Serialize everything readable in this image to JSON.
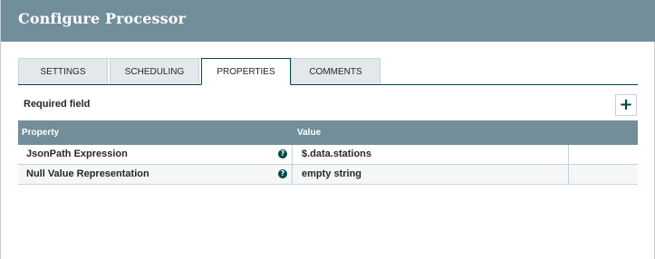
{
  "dialog": {
    "title": "Configure Processor"
  },
  "tabs": [
    {
      "label": "SETTINGS"
    },
    {
      "label": "SCHEDULING"
    },
    {
      "label": "PROPERTIES"
    },
    {
      "label": "COMMENTS"
    }
  ],
  "active_tab": "PROPERTIES",
  "properties": {
    "required_label": "Required field",
    "add_icon": "plus-icon",
    "columns": {
      "property": "Property",
      "value": "Value"
    },
    "rows": [
      {
        "name": "JsonPath Expression",
        "value": "$.data.stations",
        "help_icon": "question-icon"
      },
      {
        "name": "Null Value Representation",
        "value": "empty string",
        "help_icon": "question-icon"
      }
    ]
  },
  "colors": {
    "header": "#728e9b",
    "accent": "#004849"
  }
}
